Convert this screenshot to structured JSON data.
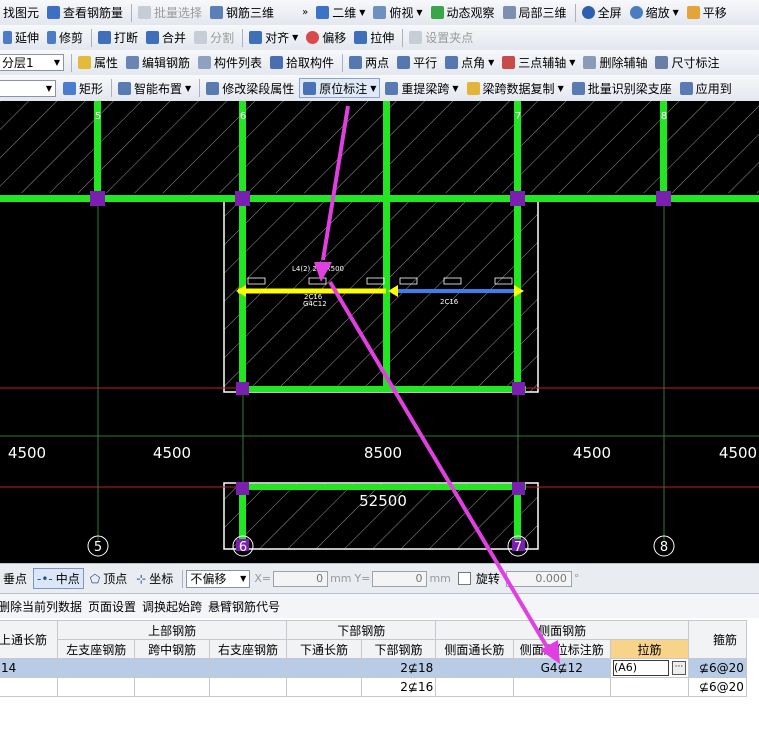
{
  "toolbar1": {
    "find_element": "找图元",
    "view_rebar_qty": "查看钢筋量",
    "batch_select": "批量选择",
    "rebar_3d": "钢筋三维",
    "view_2d": "二维",
    "top_view": "俯视",
    "dynamic_observe": "动态观察",
    "local_3d": "局部三维",
    "fullscreen": "全屏",
    "zoom": "缩放",
    "pan": "平移"
  },
  "toolbar2": {
    "extend": "延伸",
    "trim": "修剪",
    "break": "打断",
    "merge": "合并",
    "split": "分割",
    "align": "对齐",
    "offset": "偏移",
    "stretch": "拉伸",
    "set_clamp": "设置夹点"
  },
  "toolbar3": {
    "floor_selected": "分层1",
    "properties": "属性",
    "edit_rebar": "编辑钢筋",
    "component_list": "构件列表",
    "pick_component": "拾取构件",
    "two_points": "两点",
    "parallel": "平行",
    "point_angle": "点角",
    "three_point_axis": "三点辅轴",
    "delete_axis": "删除辅轴",
    "dim_mark": "尺寸标注"
  },
  "toolbar4": {
    "rectangle": "矩形",
    "smart_layout": "智能布置",
    "modify_span_props": "修改梁段属性",
    "in_situ_mark": "原位标注",
    "re_extract_span": "重提梁跨",
    "copy_span_data": "梁跨数据复制",
    "batch_identify_support": "批量识别梁支座",
    "apply_to": "应用到"
  },
  "canvas": {
    "axis_top": [
      "5",
      "6",
      "7",
      "8"
    ],
    "axis_bottom": [
      "5",
      "6",
      "7",
      "8"
    ],
    "dims": [
      "4500",
      "4500",
      "8500",
      "4500",
      "4500"
    ],
    "total_dim": "52500",
    "beam_label_top": "L4(2) 250X500",
    "beam_label_mid": "2C16",
    "beam_label_mid2": "G4C12",
    "beam_label_right": "2C16",
    "colors": {
      "background": "#000000",
      "column_green": "#22e622",
      "column_node": "#7a1fb0",
      "beam_yellow": "#ffff00",
      "beam_blue": "#3a7ff0",
      "axis_red": "#c81e1e",
      "arrow_magenta": "#e040e0"
    }
  },
  "statusbar": {
    "perpendicular": "垂点",
    "midpoint": "中点",
    "vertex": "顶点",
    "coordinate": "坐标",
    "no_offset": "不偏移",
    "x_label": "X=",
    "x_value": "0",
    "y_label": "Y=",
    "y_value": "0",
    "unit": "mm",
    "rotate": "旋转",
    "rotate_value": "0.000",
    "degree": "°"
  },
  "grid_tools": {
    "delete_col_data": "删除当前列数据",
    "page_setup": "页面设置",
    "swap_start_span": "调换起始跨",
    "cantilever_code": "悬臂钢筋代号"
  },
  "table": {
    "group_headers": {
      "top_through": "上通长筋",
      "top_rebar": "上部钢筋",
      "bottom_rebar": "下部钢筋",
      "side_rebar": "侧面钢筋",
      "stirrup": "箍筋"
    },
    "sub_headers": {
      "left_support": "左支座钢筋",
      "mid_span": "跨中钢筋",
      "right_support": "右支座钢筋",
      "bottom_through": "下通长筋",
      "bottom_rebar": "下部钢筋",
      "side_through": "侧面通长筋",
      "side_in_situ": "侧面原位标注筋",
      "tie_bar": "拉筋"
    },
    "rows": [
      {
        "top_through": "14",
        "bottom_rebar": "2⊈18",
        "side_in_situ": "G4⊈12",
        "tie_bar": "(A6)",
        "stirrup": "⊈6@20"
      },
      {
        "top_through": "",
        "bottom_rebar": "2⊈16",
        "side_in_situ": "",
        "tie_bar": "",
        "stirrup": "⊈6@20"
      }
    ]
  }
}
